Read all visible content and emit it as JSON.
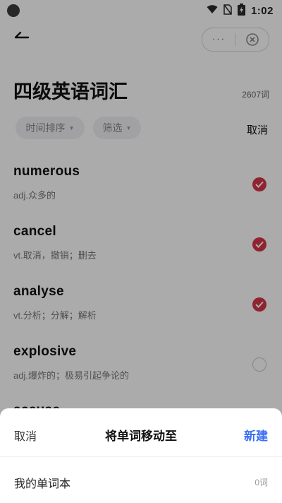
{
  "status_bar": {
    "time": "1:02"
  },
  "header": {
    "more_label": "···"
  },
  "page": {
    "title": "四级英语词汇",
    "word_count": "2607词"
  },
  "toolbar": {
    "sort_label": "时间排序",
    "filter_label": "筛选",
    "cancel_label": "取消"
  },
  "words": [
    {
      "word": "numerous",
      "meaning": "adj.众多的",
      "selected": true
    },
    {
      "word": "cancel",
      "meaning": "vt.取消，撤销；删去",
      "selected": true
    },
    {
      "word": "analyse",
      "meaning": "vt.分析；分解；解析",
      "selected": true
    },
    {
      "word": "explosive",
      "meaning": "adj.爆炸的；极易引起争论的",
      "selected": false
    }
  ],
  "partial_word": "accuse",
  "sheet": {
    "cancel_label": "取消",
    "title": "将单词移动至",
    "new_label": "新建",
    "books": [
      {
        "name": "我的单词本",
        "count": "0词"
      }
    ]
  },
  "colors": {
    "check_accent": "#d63648",
    "link_blue": "#3b6ff5"
  }
}
